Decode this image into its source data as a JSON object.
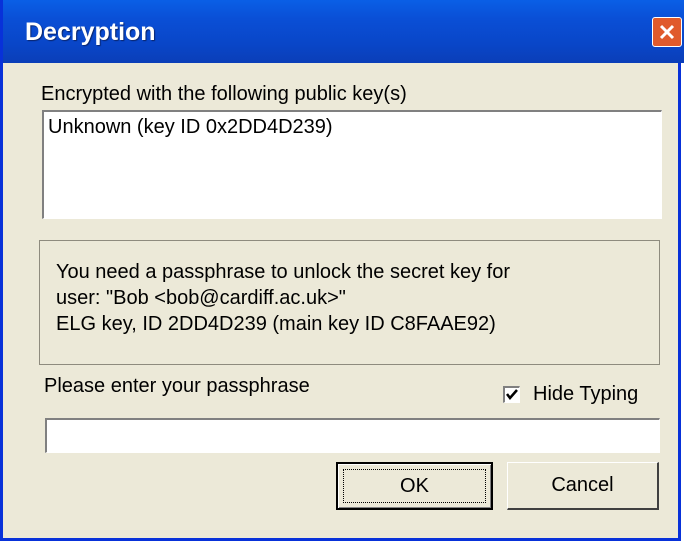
{
  "window": {
    "title": "Decryption"
  },
  "keys": {
    "header": "Encrypted with the following public key(s)",
    "items": [
      "Unknown (key ID 0x2DD4D239)"
    ]
  },
  "info": {
    "lines": [
      "You need a passphrase to unlock the secret key for",
      "user: \"Bob <bob@cardiff.ac.uk>\"",
      "ELG key, ID 2DD4D239 (main key ID C8FAAE92)"
    ]
  },
  "passphrase": {
    "label": "Please enter your passphrase",
    "value": "",
    "hide_typing_label": "Hide Typing",
    "hide_typing_checked": true
  },
  "buttons": {
    "ok": "OK",
    "cancel": "Cancel"
  },
  "icons": {
    "close": "close-icon",
    "check": "checkmark-icon"
  },
  "colors": {
    "titlebar": "#0a4fd6",
    "close": "#e05a2c",
    "dialog_bg": "#ece9d8"
  }
}
